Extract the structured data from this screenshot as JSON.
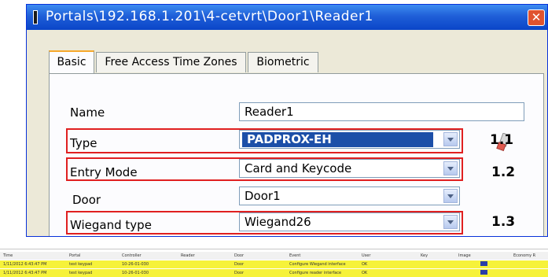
{
  "window": {
    "title": "Portals\\192.168.1.201\\4-cetvrt\\Door1\\Reader1",
    "close_glyph": "✕"
  },
  "tabs": [
    {
      "label": "Basic",
      "active": true
    },
    {
      "label": "Free Access Time Zones",
      "active": false
    },
    {
      "label": "Biometric",
      "active": false
    }
  ],
  "form": {
    "name": {
      "label": "Name",
      "value": "Reader1"
    },
    "type": {
      "label": "Type",
      "value": "PADPROX-EH",
      "callout": "1.1"
    },
    "entry_mode": {
      "label": "Entry Mode",
      "value": "Card and Keycode",
      "callout": "1.2"
    },
    "door": {
      "label": "Door",
      "value": "Door1"
    },
    "wiegand_type": {
      "label": "Wiegand type",
      "value": "Wiegand26",
      "callout": "1.3"
    }
  },
  "icons": {
    "dropdown": "chevron-down-icon",
    "type_side": "eraser-icon",
    "window": "window-icon"
  },
  "colors": {
    "titlebar": "#1f5fd8",
    "highlight_box": "#e02020",
    "selection": "#1c4fa8",
    "log_row": "#f6f23a"
  },
  "log": {
    "headers": [
      "Time",
      "Portal",
      "Controller",
      "Reader",
      "Door",
      "Event",
      "User",
      "Key",
      "Image",
      "Economy R"
    ],
    "rows": [
      [
        "1/11/2012 6:43:47 PM",
        "test keypad",
        "10-26-01-030",
        "",
        "Door",
        "Configure Wiegand interface",
        "OK",
        "",
        "",
        ""
      ],
      [
        "1/11/2012 6:43:47 PM",
        "test keypad",
        "10-26-01-030",
        "",
        "Door",
        "Configure reader interface",
        "OK",
        "",
        "",
        ""
      ]
    ]
  }
}
